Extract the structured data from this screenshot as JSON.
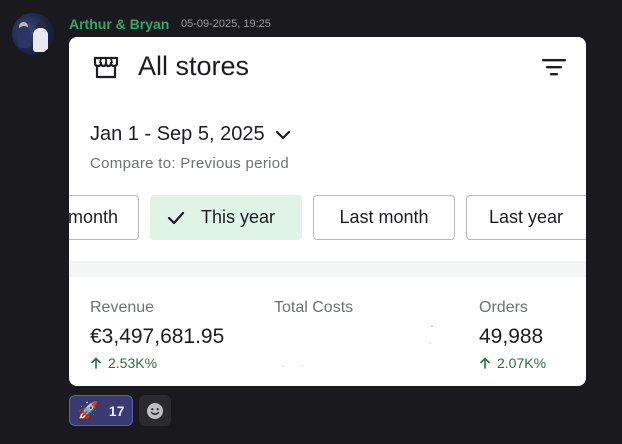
{
  "message": {
    "author": "Arthur & Bryan",
    "timestamp": "05-09-2025, 19:25",
    "author_color": "#2fa86e"
  },
  "card": {
    "title": "All stores",
    "store_icon": "store-icon",
    "filter_icon": "filter-icon",
    "date_range": "Jan 1 - Sep 5, 2025",
    "compare": "Compare to: Previous period",
    "chips": [
      {
        "label": "month",
        "selected": false
      },
      {
        "label": "This year",
        "selected": true
      },
      {
        "label": "Last month",
        "selected": false
      },
      {
        "label": "Last year",
        "selected": false
      }
    ],
    "metrics": [
      {
        "label": "Revenue",
        "value": "€3,497,681.95",
        "delta": "2.53K%"
      },
      {
        "label": "Total Costs",
        "value": "",
        "delta": ""
      },
      {
        "label": "Orders",
        "value": "49,988",
        "delta": "2.07K%"
      }
    ],
    "accent_selected_bg": "#dff3e7",
    "delta_color": "#2a6d4a"
  },
  "reactions": [
    {
      "emoji": "🚀",
      "count": "17",
      "name": "rocket"
    },
    {
      "emoji": "add-reaction",
      "count": "",
      "name": "add"
    }
  ]
}
